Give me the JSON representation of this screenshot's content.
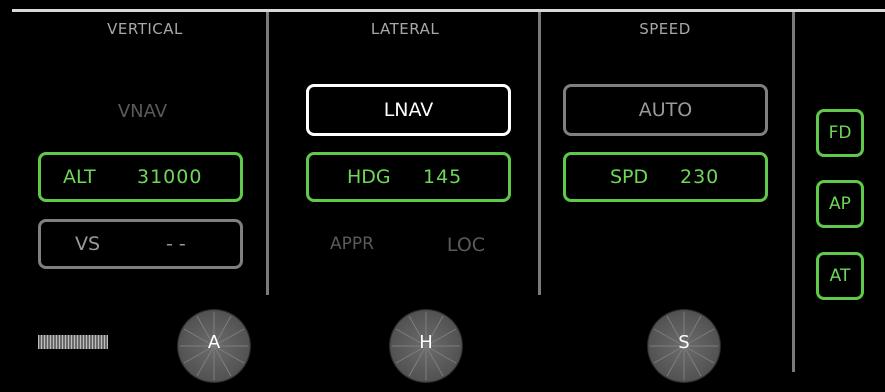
{
  "vertical": {
    "title": "VERTICAL",
    "vnav_label": "VNAV",
    "alt": {
      "label": "ALT",
      "value": "31000"
    },
    "vs": {
      "label": "VS",
      "value": "- -"
    },
    "knob_label": "A"
  },
  "lateral": {
    "title": "LATERAL",
    "lnav_label": "LNAV",
    "hdg": {
      "label": "HDG",
      "value": "145"
    },
    "appr_label": "APPR",
    "loc_label": "LOC",
    "knob_label": "H"
  },
  "speed": {
    "title": "SPEED",
    "auto_label": "AUTO",
    "spd": {
      "label": "SPD",
      "value": "230"
    },
    "knob_label": "S"
  },
  "side_buttons": {
    "fd": "FD",
    "ap": "AP",
    "at": "AT"
  },
  "colors": {
    "active": "#6fd65a",
    "armed": "#ffffff",
    "inactive": "#7f7f7f"
  }
}
